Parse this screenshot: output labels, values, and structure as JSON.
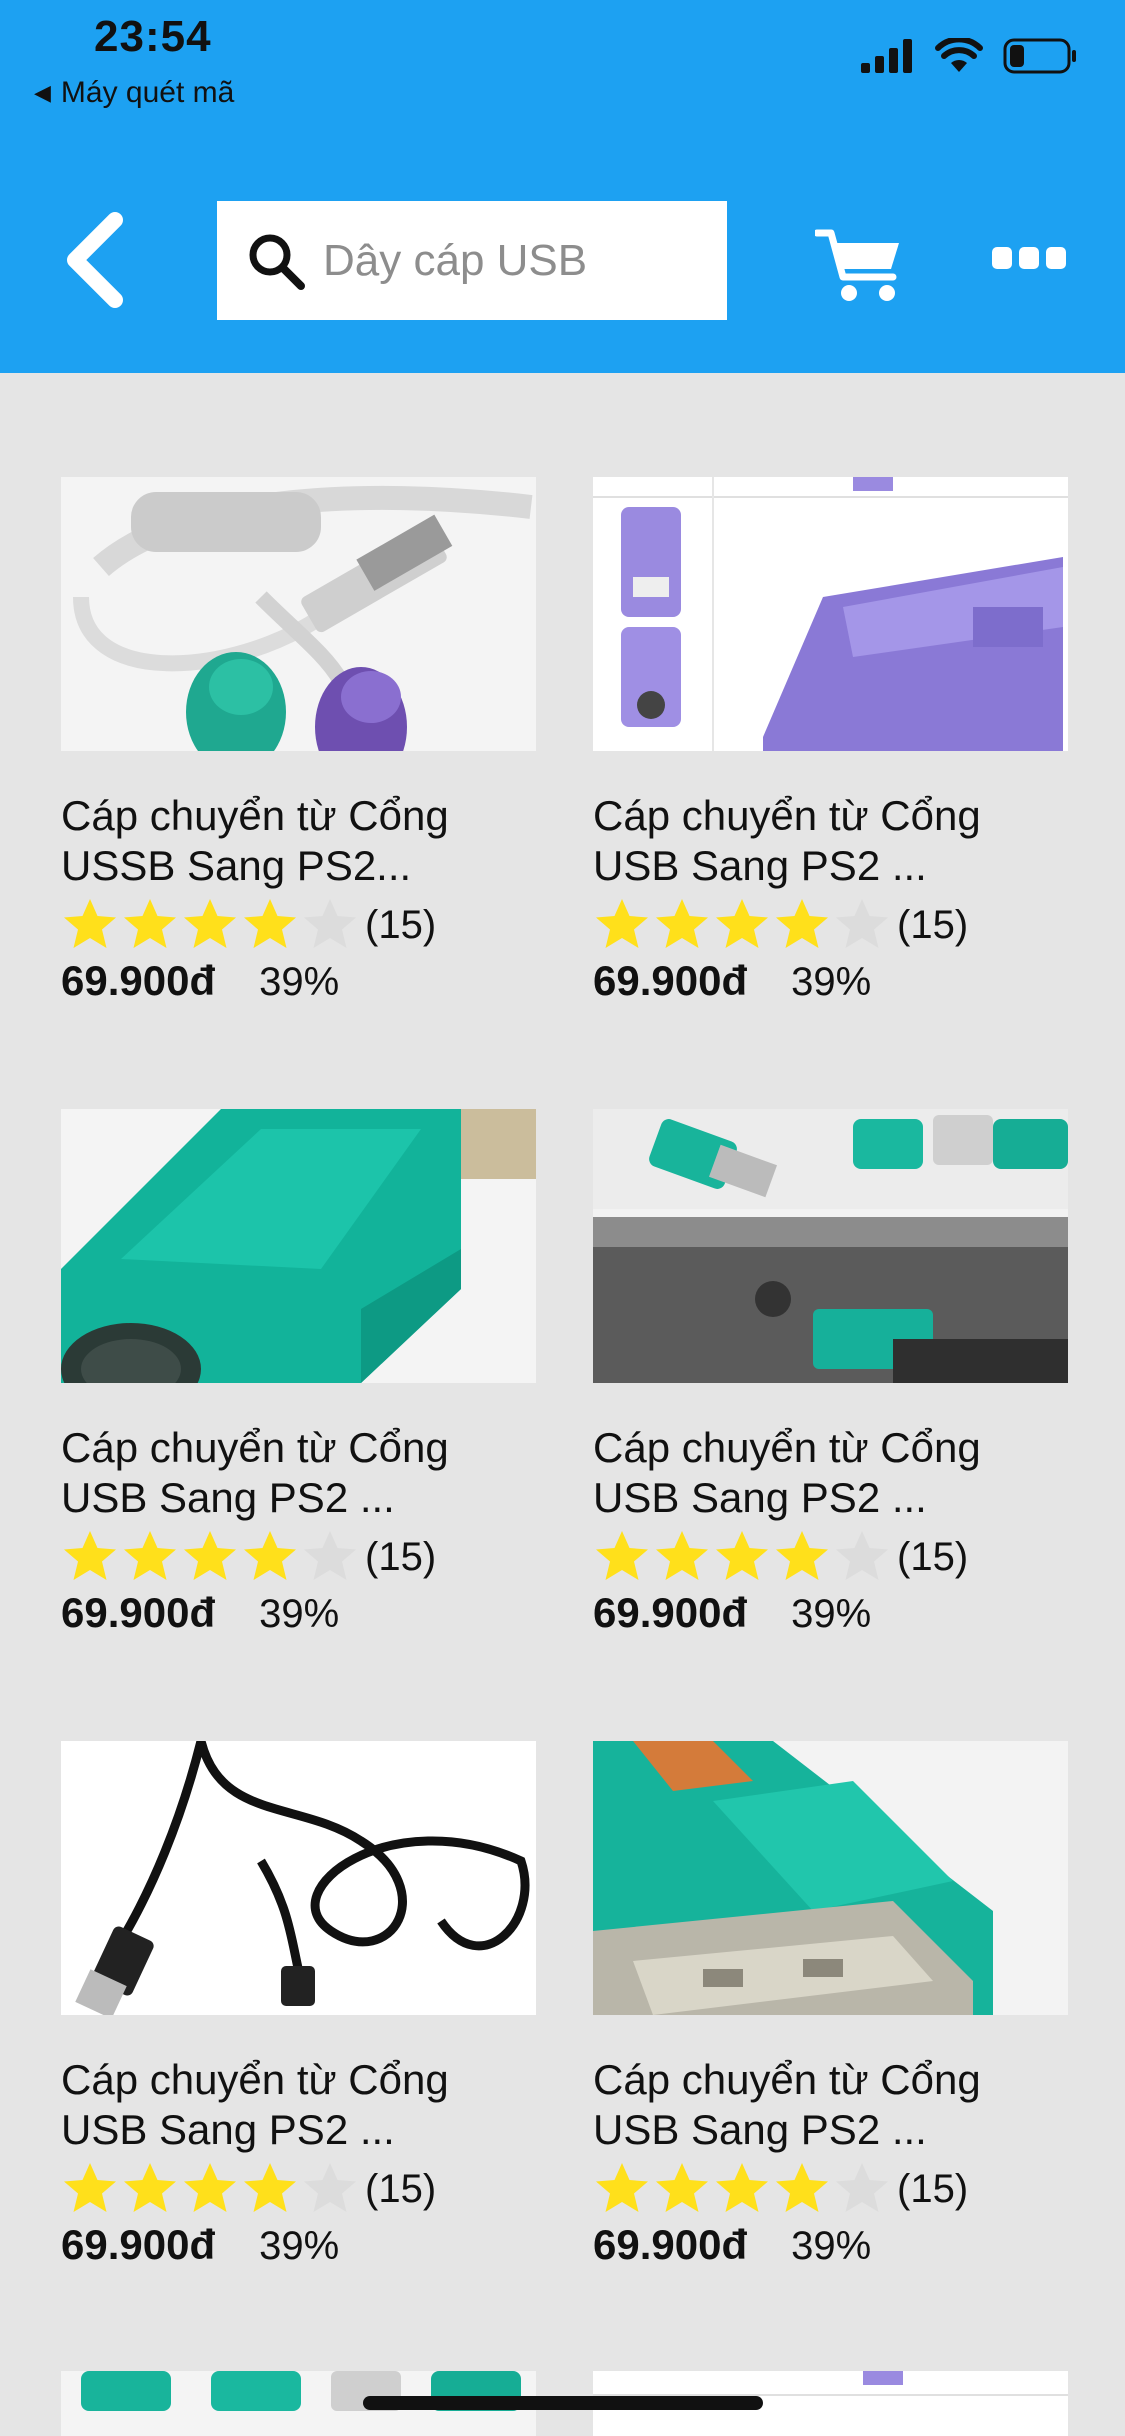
{
  "status_bar": {
    "time": "23:54",
    "back_app_label": "Máy quét mã"
  },
  "search": {
    "placeholder": "Dây cáp USB"
  },
  "colors": {
    "header": "#1da1f2",
    "background": "#e5e5e5",
    "star_filled": "#ffe01b",
    "star_empty": "#dcdcdc"
  },
  "icons": {
    "back": "chevron-left-icon",
    "search": "search-icon",
    "cart": "cart-icon",
    "more": "more-icon"
  },
  "products": [
    {
      "title_line1": "Cáp chuyển từ Cổng",
      "title_line2": "USSB Sang PS2...",
      "stars": 4,
      "count": "(15)",
      "price": "69.900đ",
      "discount": "39%",
      "image": "cable-purple-green"
    },
    {
      "title_line1": "Cáp chuyển từ Cổng",
      "title_line2": "USB Sang PS2 ...",
      "stars": 4,
      "count": "(15)",
      "price": "69.900đ",
      "discount": "39%",
      "image": "adapter-purple"
    },
    {
      "title_line1": "Cáp chuyển từ Cổng",
      "title_line2": "USB Sang PS2 ...",
      "stars": 4,
      "count": "(15)",
      "price": "69.900đ",
      "discount": "39%",
      "image": "adapter-green"
    },
    {
      "title_line1": "Cáp chuyển từ Cổng",
      "title_line2": "USB Sang PS2 ...",
      "stars": 4,
      "count": "(15)",
      "price": "69.900đ",
      "discount": "39%",
      "image": "adapter-green-photo"
    },
    {
      "title_line1": "Cáp chuyển từ Cổng",
      "title_line2": "USB Sang PS2 ...",
      "stars": 4,
      "count": "(15)",
      "price": "69.900đ",
      "discount": "39%",
      "image": "black-cable"
    },
    {
      "title_line1": "Cáp chuyển từ Cổng",
      "title_line2": "USB Sang PS2 ...",
      "stars": 4,
      "count": "(15)",
      "price": "69.900đ",
      "discount": "39%",
      "image": "adapter-green-closeup"
    }
  ]
}
